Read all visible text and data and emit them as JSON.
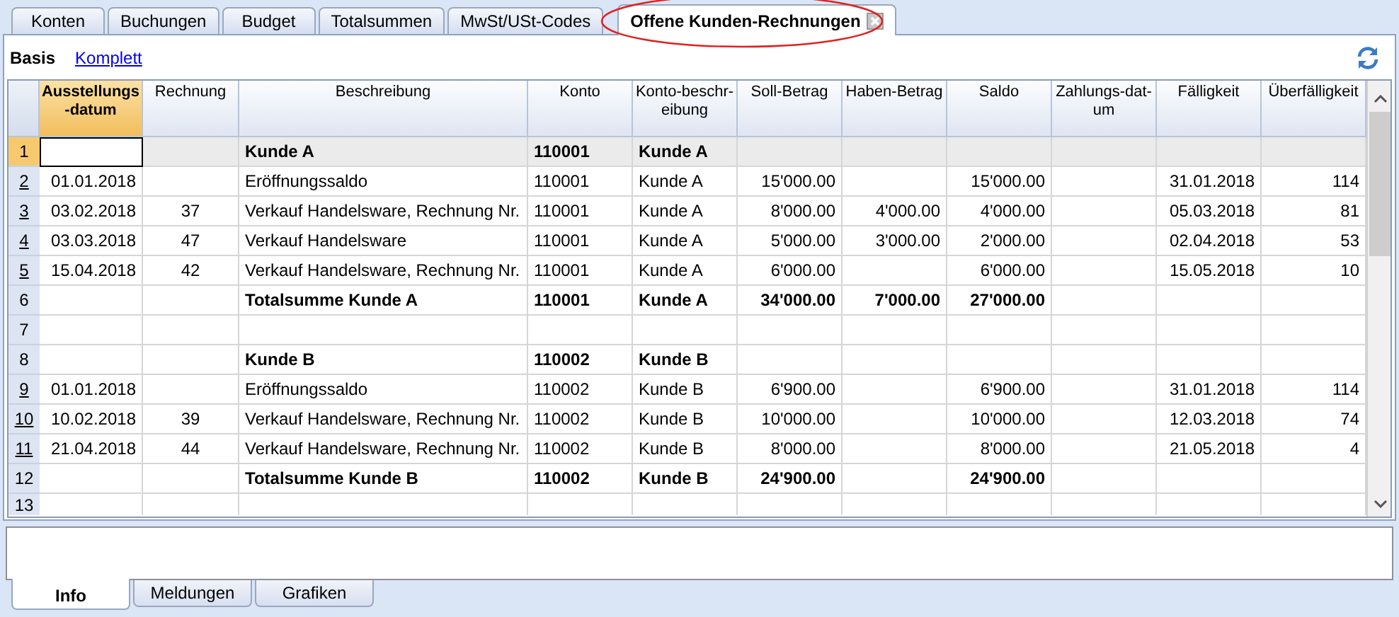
{
  "tabs": [
    {
      "label": "Konten",
      "selected": false,
      "highlighted": false
    },
    {
      "label": "Buchungen",
      "selected": false,
      "highlighted": false
    },
    {
      "label": "Budget",
      "selected": false,
      "highlighted": false
    },
    {
      "label": "Totalsummen",
      "selected": false,
      "highlighted": false
    },
    {
      "label": "MwSt/USt-Codes",
      "selected": false,
      "highlighted": false
    },
    {
      "label": "Offene Kunden-Rechnungen",
      "selected": true,
      "highlighted": true
    }
  ],
  "views": [
    {
      "label": "Basis",
      "selected": true
    },
    {
      "label": "Komplett",
      "selected": false
    }
  ],
  "table": {
    "columns": [
      {
        "label": "Ausstellungs-datum",
        "selected": true
      },
      {
        "label": "Rechnung",
        "selected": false
      },
      {
        "label": "Beschreibung",
        "selected": false
      },
      {
        "label": "Konto",
        "selected": false
      },
      {
        "label": "Konto-beschr-eibung",
        "selected": false
      },
      {
        "label": "Soll-Betrag",
        "selected": false
      },
      {
        "label": "Haben-Betrag",
        "selected": false
      },
      {
        "label": "Saldo",
        "selected": false
      },
      {
        "label": "Zahlungs-dat-um",
        "selected": false
      },
      {
        "label": "Fälligkeit",
        "selected": false
      },
      {
        "label": "Überfälligkeit",
        "selected": false
      }
    ],
    "rows": [
      {
        "number": "1",
        "selected": true,
        "linked": false,
        "kind": "group",
        "cells": [
          null,
          null,
          "Kunde A",
          "110001",
          "Kunde A",
          null,
          null,
          null,
          null,
          null,
          null
        ]
      },
      {
        "number": "2",
        "selected": false,
        "linked": true,
        "kind": "entry",
        "cells": [
          "01.01.2018",
          null,
          "Eröffnungssaldo",
          "110001",
          "Kunde A",
          "15'000.00",
          null,
          "15'000.00",
          null,
          "31.01.2018",
          "114"
        ]
      },
      {
        "number": "3",
        "selected": false,
        "linked": true,
        "kind": "entry",
        "cells": [
          "03.02.2018",
          "37",
          "Verkauf Handelsware, Rechnung Nr.",
          "110001",
          "Kunde A",
          "8'000.00",
          "4'000.00",
          "4'000.00",
          null,
          "05.03.2018",
          "81"
        ]
      },
      {
        "number": "4",
        "selected": false,
        "linked": true,
        "kind": "entry",
        "cells": [
          "03.03.2018",
          "47",
          "Verkauf Handelsware",
          "110001",
          "Kunde A",
          "5'000.00",
          "3'000.00",
          "2'000.00",
          null,
          "02.04.2018",
          "53"
        ]
      },
      {
        "number": "5",
        "selected": false,
        "linked": true,
        "kind": "entry",
        "cells": [
          "15.04.2018",
          "42",
          "Verkauf Handelsware, Rechnung Nr.",
          "110001",
          "Kunde A",
          "6'000.00",
          null,
          "6'000.00",
          null,
          "15.05.2018",
          "10"
        ]
      },
      {
        "number": "6",
        "selected": false,
        "linked": false,
        "kind": "total",
        "cells": [
          null,
          null,
          "Totalsumme Kunde A",
          "110001",
          "Kunde A",
          "34'000.00",
          "7'000.00",
          "27'000.00",
          null,
          null,
          null
        ]
      },
      {
        "number": "7",
        "selected": false,
        "linked": false,
        "kind": "blank",
        "cells": [
          null,
          null,
          null,
          null,
          null,
          null,
          null,
          null,
          null,
          null,
          null
        ]
      },
      {
        "number": "8",
        "selected": false,
        "linked": false,
        "kind": "group",
        "cells": [
          null,
          null,
          "Kunde B",
          "110002",
          "Kunde B",
          null,
          null,
          null,
          null,
          null,
          null
        ]
      },
      {
        "number": "9",
        "selected": false,
        "linked": true,
        "kind": "entry",
        "cells": [
          "01.01.2018",
          null,
          "Eröffnungssaldo",
          "110002",
          "Kunde B",
          "6'900.00",
          null,
          "6'900.00",
          null,
          "31.01.2018",
          "114"
        ]
      },
      {
        "number": "10",
        "selected": false,
        "linked": true,
        "kind": "entry",
        "cells": [
          "10.02.2018",
          "39",
          "Verkauf Handelsware, Rechnung Nr.",
          "110002",
          "Kunde B",
          "10'000.00",
          null,
          "10'000.00",
          null,
          "12.03.2018",
          "74"
        ]
      },
      {
        "number": "11",
        "selected": false,
        "linked": true,
        "kind": "entry",
        "cells": [
          "21.04.2018",
          "44",
          "Verkauf Handelsware, Rechnung Nr.",
          "110002",
          "Kunde B",
          "8'000.00",
          null,
          "8'000.00",
          null,
          "21.05.2018",
          "4"
        ]
      },
      {
        "number": "12",
        "selected": false,
        "linked": false,
        "kind": "total",
        "cells": [
          null,
          null,
          "Totalsumme Kunde B",
          "110002",
          "Kunde B",
          "24'900.00",
          null,
          "24'900.00",
          null,
          null,
          null
        ]
      },
      {
        "number": "13",
        "selected": false,
        "linked": false,
        "kind": "blank",
        "cells": [
          null,
          null,
          null,
          null,
          null,
          null,
          null,
          null,
          null,
          null,
          null
        ]
      }
    ]
  },
  "bottom_tabs": [
    {
      "label": "Info",
      "selected": true
    },
    {
      "label": "Meldungen",
      "selected": false
    },
    {
      "label": "Grafiken",
      "selected": false
    }
  ]
}
